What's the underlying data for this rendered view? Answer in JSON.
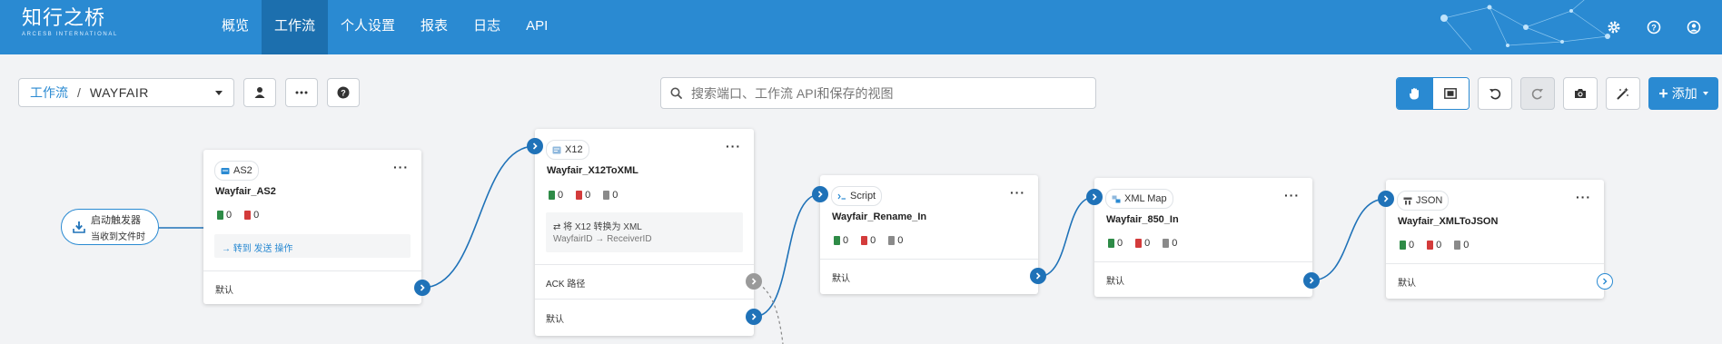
{
  "brand": {
    "logo_zh": "知行之桥",
    "logo_en": "ARCESB INTERNATIONAL"
  },
  "nav": {
    "items": [
      {
        "label": "概览",
        "active": false
      },
      {
        "label": "工作流",
        "active": true
      },
      {
        "label": "个人设置",
        "active": false
      },
      {
        "label": "报表",
        "active": false
      },
      {
        "label": "日志",
        "active": false
      },
      {
        "label": "API",
        "active": false
      }
    ]
  },
  "header_icons": [
    "gear-icon",
    "help-icon",
    "user-icon"
  ],
  "toolbar": {
    "breadcrumb_root": "工作流",
    "breadcrumb_sep": "/",
    "workspace": "WAYFAIR",
    "search_placeholder": "搜索端口、工作流 API和保存的视图",
    "add_label": "添加"
  },
  "colors": {
    "primary": "#2a8ad2",
    "nav_active": "#1c6fae",
    "port": "#1f72b8",
    "success": "#2e8b47",
    "error": "#d33b3b"
  },
  "trigger": {
    "line1": "启动触发器",
    "line2": "当收到文件时"
  },
  "nodes": {
    "as2": {
      "type": "AS2",
      "name": "Wayfair_AS2",
      "success": "0",
      "error": "0",
      "pending": "",
      "note": "→ 转到 发送 操作",
      "port_label": "默认"
    },
    "x12": {
      "type": "X12",
      "name": "Wayfair_X12ToXML",
      "success": "0",
      "error": "0",
      "pending": "0",
      "info_line1": "⇄ 将 X12 转换为 XML",
      "info_line2": "WayfairID → ReceiverID",
      "ack_label": "ACK 路径",
      "port_label": "默认"
    },
    "script": {
      "type": "Script",
      "name": "Wayfair_Rename_In",
      "success": "0",
      "error": "0",
      "pending": "0",
      "port_label": "默认"
    },
    "xmlmap": {
      "type": "XML Map",
      "name": "Wayfair_850_In",
      "success": "0",
      "error": "0",
      "pending": "0",
      "port_label": "默认"
    },
    "json": {
      "type": "JSON",
      "name": "Wayfair_XMLToJSON",
      "success": "0",
      "error": "0",
      "pending": "0",
      "port_label": "默认"
    }
  }
}
